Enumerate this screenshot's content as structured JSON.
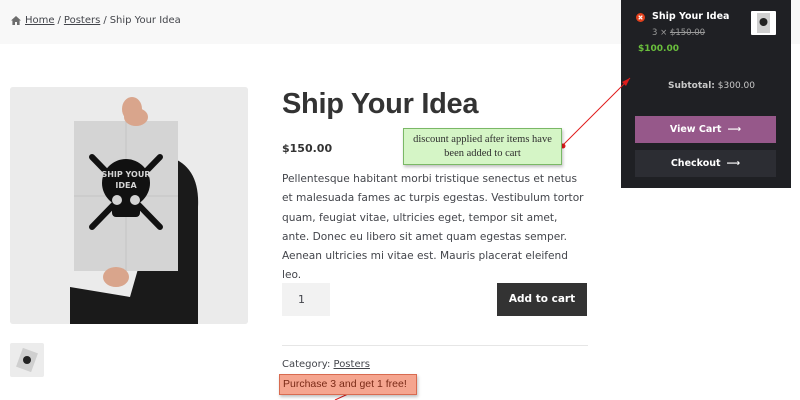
{
  "breadcrumb": {
    "home": "Home",
    "posters": "Posters",
    "separator": "/",
    "current": "Ship Your Idea"
  },
  "product": {
    "title": "Ship Your Idea",
    "price": "$150.00",
    "description": "Pellentesque habitant morbi tristique senectus et netus et malesuada fames ac turpis egestas. Vestibulum tortor quam, feugiat vitae, ultricies eget, tempor sit amet, ante. Donec eu libero sit amet quam egestas semper. Aenean ultricies mi vitae est. Mauris placerat eleifend leo.",
    "quantity": "1",
    "add_to_cart": "Add to cart",
    "category_label": "Category:",
    "category": "Posters",
    "poster_text_line1": "SHIP YOUR",
    "poster_text_line2": "IDEA"
  },
  "mini_cart": {
    "item_name": "Ship Your Idea",
    "item_qty": "3 ×",
    "item_old_price": "$150.00",
    "item_new_price": "$100.00",
    "subtotal_label": "Subtotal:",
    "subtotal_value": "$300.00",
    "view_cart": "View Cart",
    "checkout": "Checkout",
    "arrow": "⟶"
  },
  "annotations": {
    "green_note": "discount applied after items have been added to cart",
    "red_note": "Purchase 3 and get 1 free!"
  },
  "icons": {
    "home": "home-icon",
    "remove": "remove-icon",
    "arrow": "arrow-right-icon"
  },
  "colors": {
    "mini_cart_bg": "#1f2024",
    "view_cart_button": "#96588a",
    "discount_price": "#6abf3c",
    "add_to_cart_button": "#333333"
  }
}
